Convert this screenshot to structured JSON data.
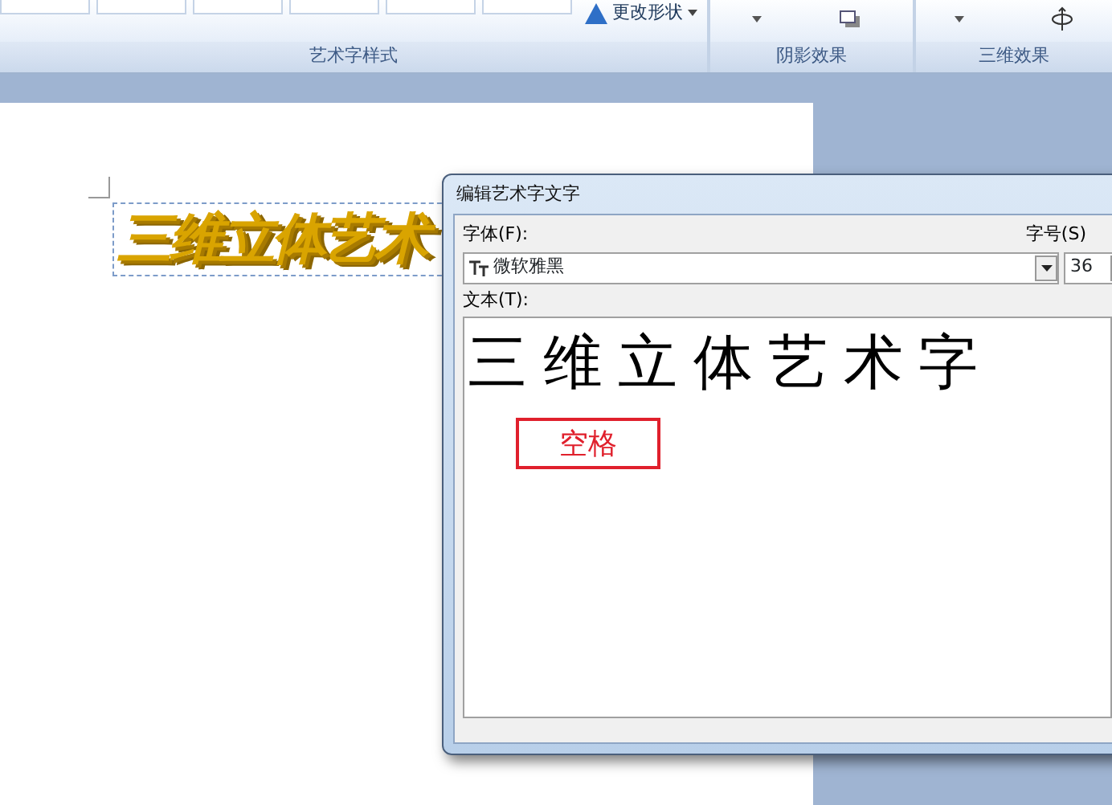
{
  "ribbon": {
    "change_shape": "更改形状",
    "groups": [
      {
        "label": "艺术字样式"
      },
      {
        "label": "阴影效果"
      },
      {
        "label": "三维效果"
      }
    ]
  },
  "document": {
    "wordart": "三维立体艺术"
  },
  "dialog": {
    "title": "编辑艺术字文字",
    "font_label": "字体(F):",
    "font_value": "微软雅黑",
    "size_label": "字号(S)",
    "size_value": "36",
    "text_label": "文本(T):",
    "text_value": "三 维 立 体 艺 术 字",
    "callout": "空格"
  }
}
